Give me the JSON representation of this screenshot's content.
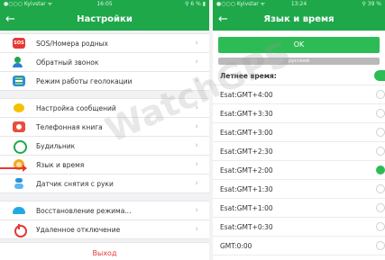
{
  "left_screen": {
    "status_bar": {
      "carrier": "●○○○ Kyivstar ᯤ",
      "time": "16:05",
      "battery": "⚲ 6 % ▮"
    },
    "nav": {
      "back_glyph": "←",
      "title": "Настройки"
    },
    "menu_groups": [
      [
        {
          "icon": "sos-icon",
          "icon_text": "SOS",
          "label": "SOS/Номера родных"
        },
        {
          "icon": "phone-callback-icon",
          "label": "Обратный звонок"
        },
        {
          "icon": "geolocation-icon",
          "label": "Режим работы геолокации"
        }
      ],
      [
        {
          "icon": "message-icon",
          "label": "Настройка сообщений"
        },
        {
          "icon": "phonebook-icon",
          "label": "Телефонная книга"
        },
        {
          "icon": "alarm-icon",
          "label": "Будильник"
        },
        {
          "icon": "language-icon",
          "label": "Язык и время"
        },
        {
          "icon": "wrist-sensor-icon",
          "label": "Датчик снятия с руки"
        }
      ],
      [
        {
          "icon": "restore-icon",
          "label": "Восстановление режима..."
        },
        {
          "icon": "power-icon",
          "label": "Удаленное отключение"
        }
      ]
    ],
    "exit_label": "Выход",
    "chevron": "›"
  },
  "right_screen": {
    "status_bar": {
      "carrier": "●○○○ Kyivstar ᯤ",
      "time": "13:24",
      "battery": "⚲ 39 %"
    },
    "nav": {
      "back_glyph": "←",
      "title": "Язык и время"
    },
    "ok_label": "OK",
    "language_value": "русский",
    "summer_time_label": "Летнее время:",
    "timezones": [
      {
        "label": "Esat:GMT+4:00",
        "selected": false
      },
      {
        "label": "Esat:GMT+3:30",
        "selected": false
      },
      {
        "label": "Esat:GMT+3:00",
        "selected": false
      },
      {
        "label": "Esat:GMT+2:30",
        "selected": false
      },
      {
        "label": "Esat:GMT+2:00",
        "selected": true
      },
      {
        "label": "Esat:GMT+1:30",
        "selected": false
      },
      {
        "label": "Esat:GMT+1:00",
        "selected": false
      },
      {
        "label": "Esat:GMT+0:30",
        "selected": false
      },
      {
        "label": "GMT:0:00",
        "selected": false
      }
    ]
  },
  "watermark": "WatchGPS",
  "colors": {
    "accent_green": "#1ea84a",
    "exit_red": "#e53935"
  }
}
